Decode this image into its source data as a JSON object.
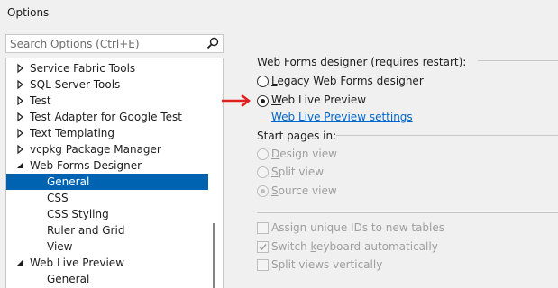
{
  "window": {
    "title": "Options"
  },
  "search": {
    "placeholder": "Search Options (Ctrl+E)",
    "icon": "search-icon"
  },
  "tree": {
    "items": [
      {
        "label": "Service Fabric Tools",
        "state": "collapsed"
      },
      {
        "label": "SQL Server Tools",
        "state": "collapsed"
      },
      {
        "label": "Test",
        "state": "collapsed"
      },
      {
        "label": "Test Adapter for Google Test",
        "state": "collapsed"
      },
      {
        "label": "Text Templating",
        "state": "collapsed"
      },
      {
        "label": "vcpkg Package Manager",
        "state": "collapsed"
      },
      {
        "label": "Web Forms Designer",
        "state": "expanded"
      },
      {
        "label": "General",
        "state": "leaf",
        "selected": true
      },
      {
        "label": "CSS",
        "state": "leaf"
      },
      {
        "label": "CSS Styling",
        "state": "leaf"
      },
      {
        "label": "Ruler and Grid",
        "state": "leaf"
      },
      {
        "label": "View",
        "state": "leaf"
      },
      {
        "label": "Web Live Preview",
        "state": "expanded"
      },
      {
        "label": "General",
        "state": "leaf"
      }
    ],
    "selection_color": "#0063b1"
  },
  "panel": {
    "designer_group": "Web Forms designer (requires restart):",
    "legacy_option": "Legacy Web Forms designer",
    "legacy_selected": false,
    "live_option": "Web Live Preview",
    "live_selected": true,
    "live_settings_link": "Web Live Preview settings",
    "start_pages_group": "Start pages in:",
    "design_view": "Design view",
    "split_view": "Split view",
    "source_view": "Source view",
    "source_selected": true,
    "assign_ids": "Assign unique IDs to new tables",
    "switch_keyboard": "Switch keyboard automatically",
    "switch_keyboard_checked": true,
    "split_vertically": "Split views vertically",
    "link_color": "#0066cc",
    "annotation_arrow_color": "#e02020"
  }
}
